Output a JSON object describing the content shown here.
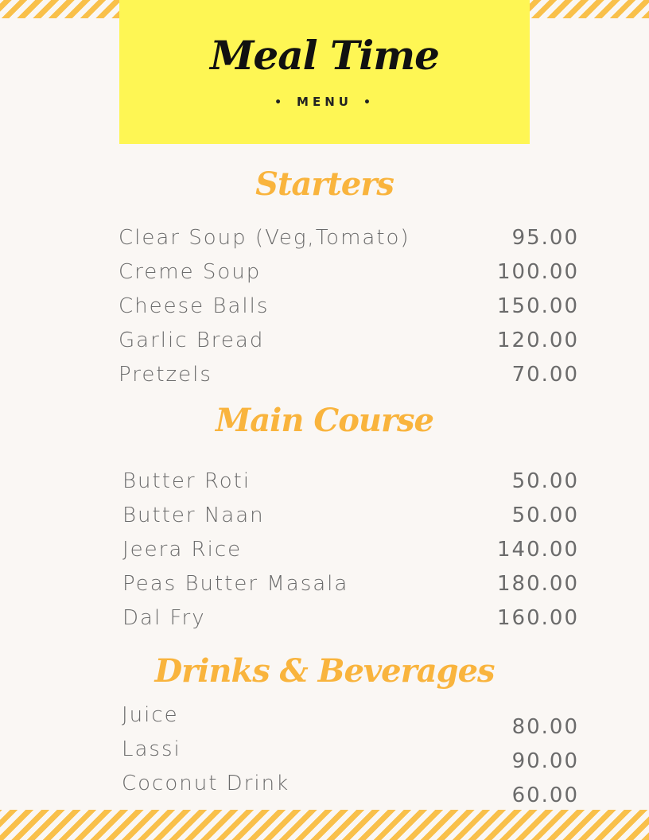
{
  "header": {
    "title": "Meal Time",
    "subtitle": "MENU",
    "dot": "•"
  },
  "colors": {
    "header_bg": "#fef654",
    "accent": "#f9b43d",
    "stripe": "#f9c04a",
    "text": "#6b6b6b"
  },
  "sections": [
    {
      "title": "Starters",
      "items": [
        {
          "name": "Clear Soup (Veg,Tomato)",
          "price": "95.00"
        },
        {
          "name": "Creme Soup",
          "price": "100.00"
        },
        {
          "name": "Cheese Balls",
          "price": "150.00"
        },
        {
          "name": "Garlic Bread",
          "price": "120.00"
        },
        {
          "name": "Pretzels",
          "price": "70.00"
        }
      ]
    },
    {
      "title": "Main Course",
      "items": [
        {
          "name": "Butter Roti",
          "price": "50.00"
        },
        {
          "name": "Butter Naan",
          "price": "50.00"
        },
        {
          "name": "Jeera Rice",
          "price": "140.00"
        },
        {
          "name": "Peas Butter Masala",
          "price": "180.00"
        },
        {
          "name": "Dal Fry",
          "price": "160.00"
        }
      ]
    },
    {
      "title": "Drinks & Beverages",
      "items": [
        {
          "name": "Juice",
          "price": "80.00"
        },
        {
          "name": "Lassi",
          "price": "90.00"
        },
        {
          "name": "Coconut Drink",
          "price": "60.00"
        }
      ]
    }
  ]
}
